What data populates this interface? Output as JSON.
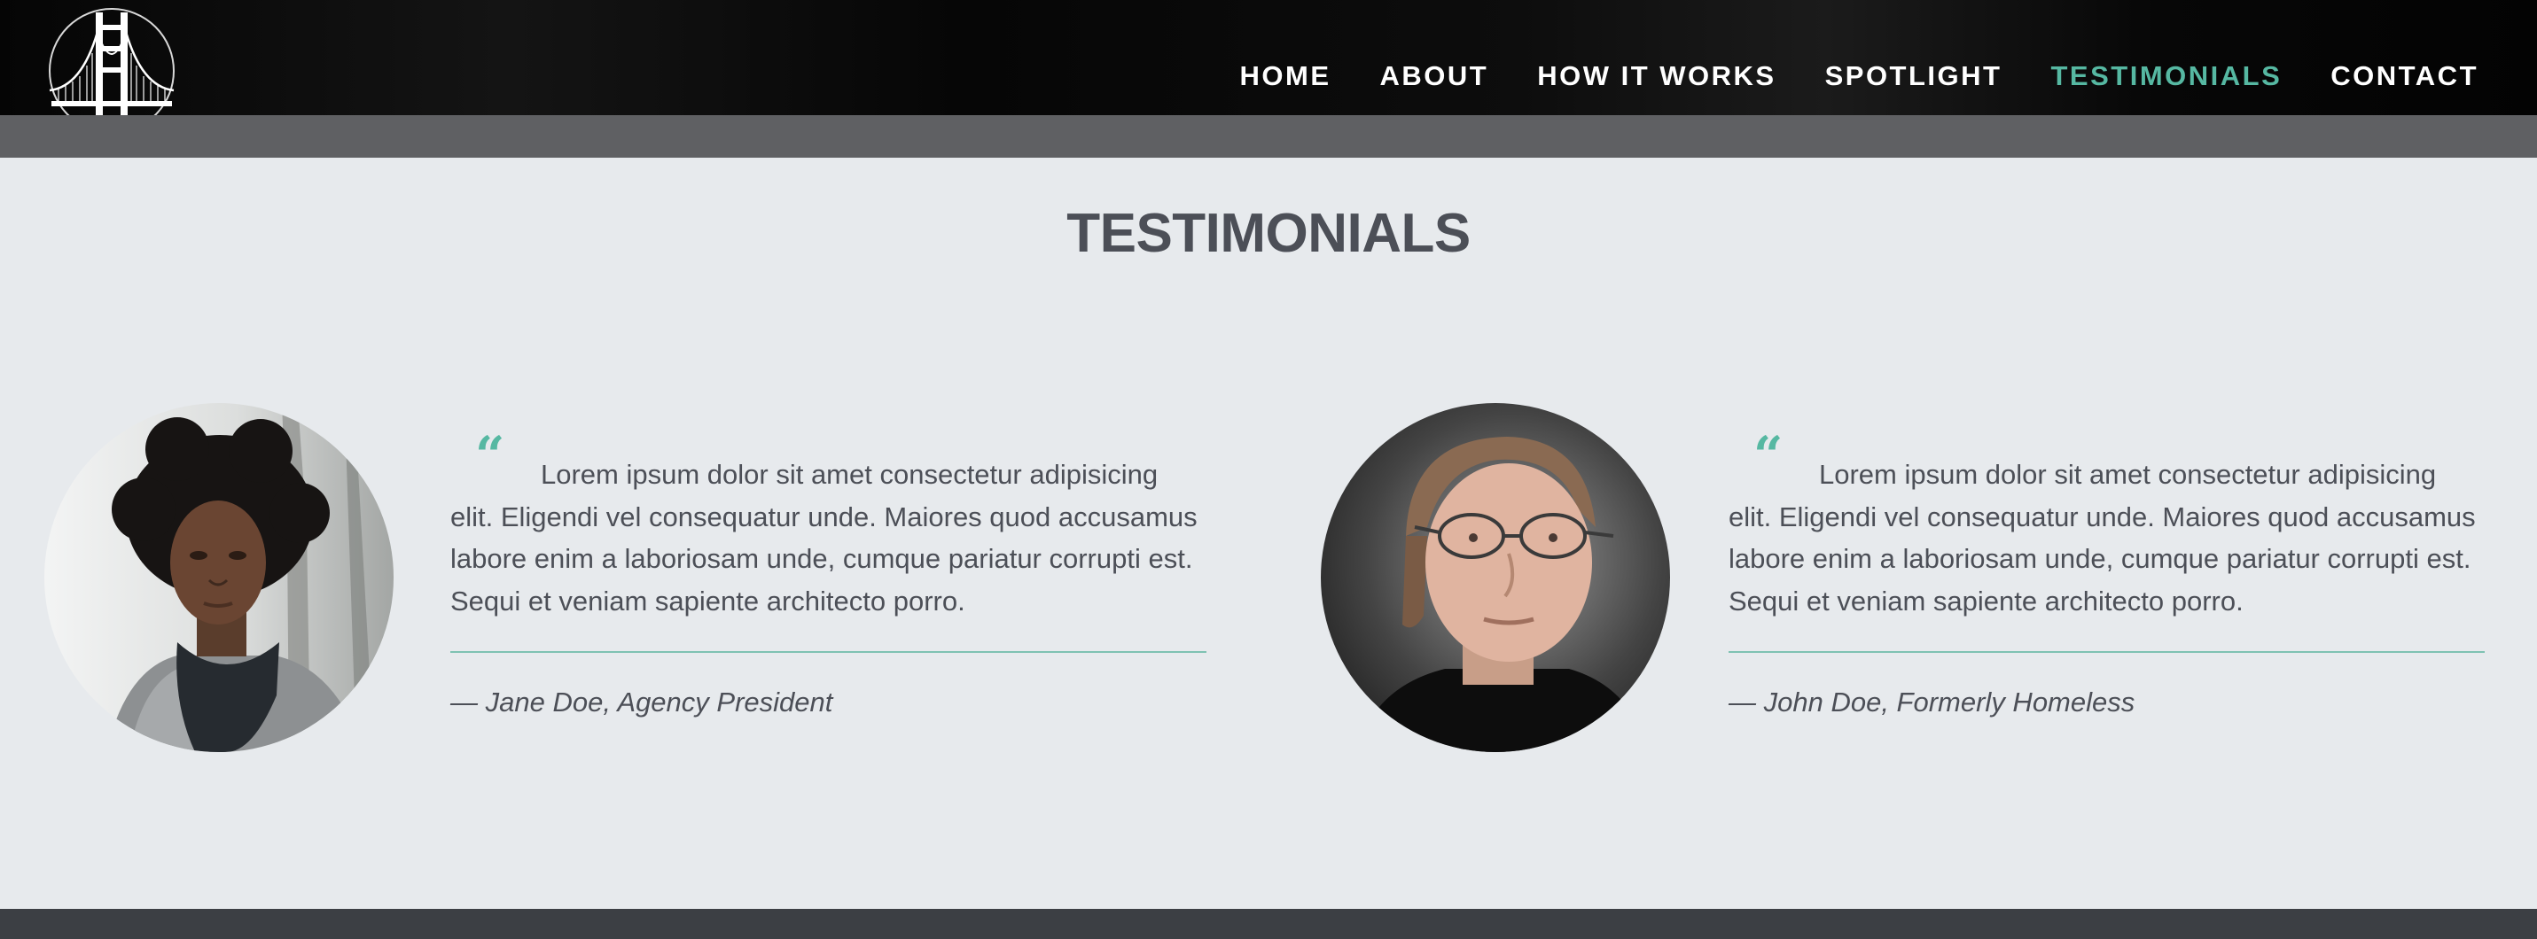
{
  "header": {
    "logo_icon": "golden-gate-bridge-icon",
    "nav": [
      {
        "label": "HOME"
      },
      {
        "label": "ABOUT"
      },
      {
        "label": "HOW IT WORKS"
      },
      {
        "label": "SPOTLIGHT"
      },
      {
        "label": "TESTIMONIALS",
        "active": true
      },
      {
        "label": "CONTACT"
      }
    ]
  },
  "section": {
    "title": "TESTIMONIALS"
  },
  "testimonials": [
    {
      "photo_icon": "woman-portrait",
      "quote_icon": "quote-icon",
      "quote": "Lorem ipsum dolor sit amet consectetur adipisicing elit. Eligendi vel consequatur unde. Maiores quod accusamus labore enim a laboriosam unde, cumque pariatur corrupti est. Sequi et veniam sapiente architecto porro.",
      "author": "— Jane Doe, Agency President"
    },
    {
      "photo_icon": "man-portrait",
      "quote_icon": "quote-icon",
      "quote": "Lorem ipsum dolor sit amet consectetur adipisicing elit. Eligendi vel consequatur unde. Maiores quod accusamus labore enim a laboriosam unde, cumque pariatur corrupti est. Sequi et veniam sapiente architecto porro.",
      "author": "— John Doe, Formerly Homeless"
    }
  ],
  "colors": {
    "accent": "#56b8a2",
    "text": "#4c4f57",
    "background": "#e7eaed",
    "header": "#050505",
    "header_strip": "#5f6063",
    "footer": "#3c3f44"
  }
}
